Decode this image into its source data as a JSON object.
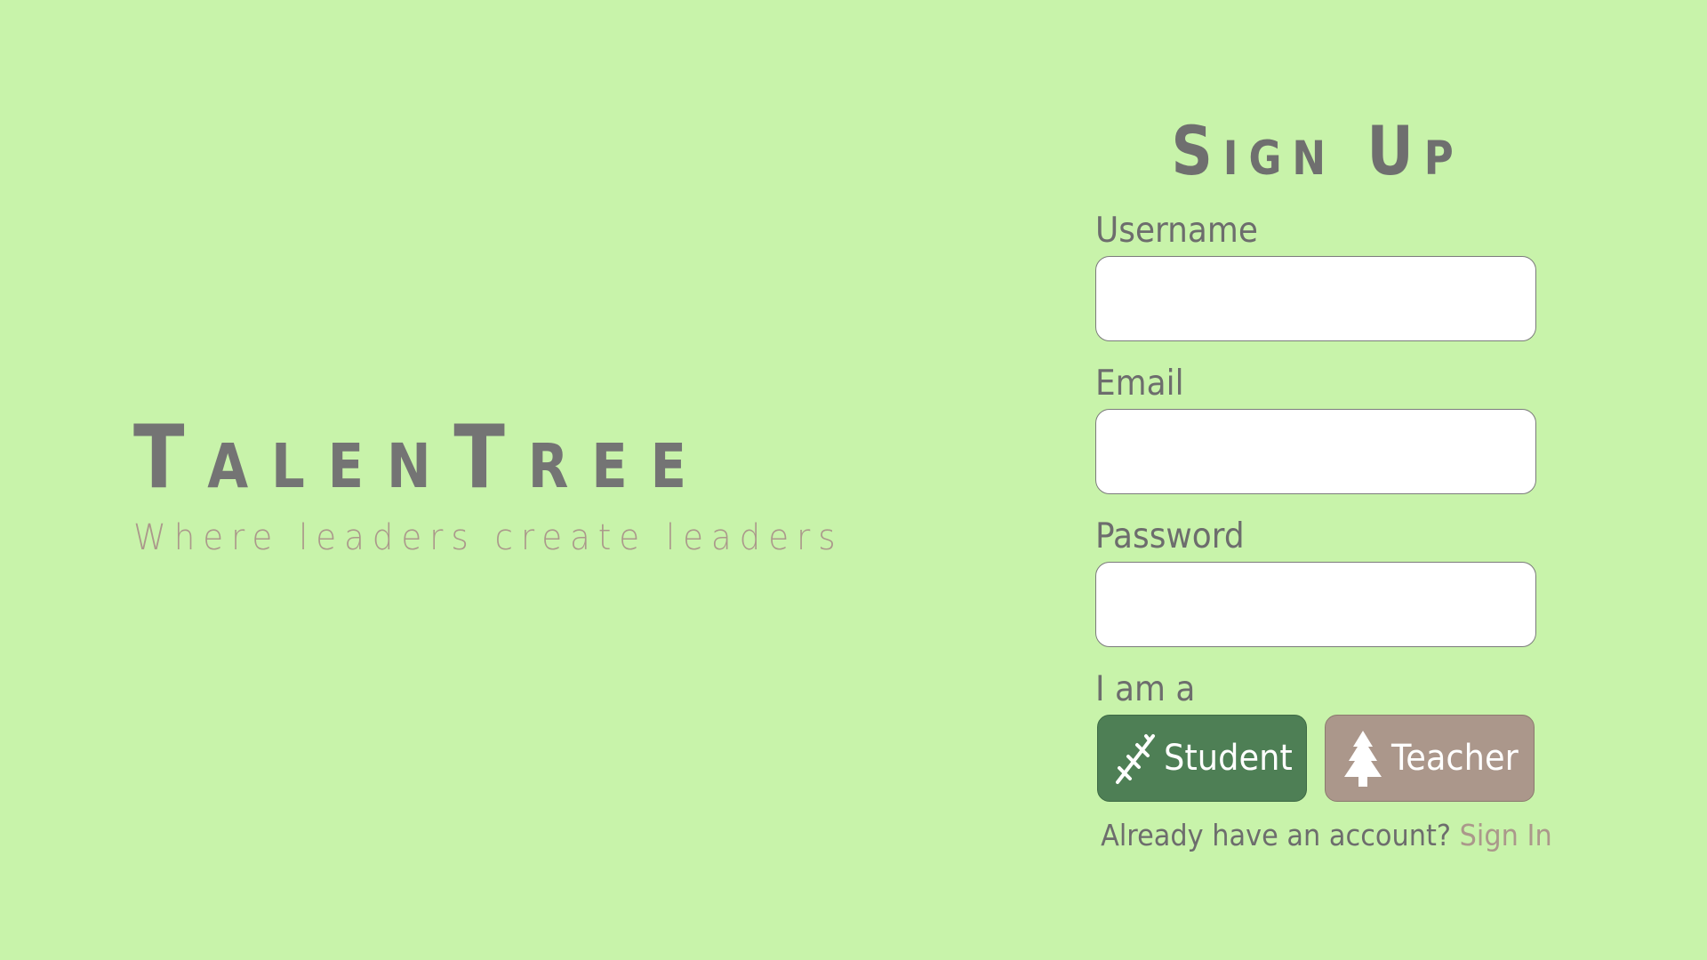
{
  "brand": {
    "title": "TalenTree",
    "tagline": "Where leaders create leaders"
  },
  "signup": {
    "title": "Sign Up",
    "username": {
      "label": "Username",
      "value": "",
      "placeholder": ""
    },
    "email": {
      "label": "Email",
      "value": "",
      "placeholder": ""
    },
    "password": {
      "label": "Password",
      "value": "",
      "placeholder": ""
    },
    "role_prompt": "I am a",
    "roles": [
      {
        "label": "Student",
        "icon": "sapling-icon",
        "color": "#4e7f55"
      },
      {
        "label": "Teacher",
        "icon": "tree-icon",
        "color": "#ab978b"
      }
    ],
    "signin_prompt": "Already have an account?",
    "signin_link": "Sign In"
  },
  "colors": {
    "background": "#c8f3aa",
    "text": "#6d6d6d",
    "accent": "#ab988b",
    "student": "#4e7f55",
    "teacher": "#ab978b"
  }
}
